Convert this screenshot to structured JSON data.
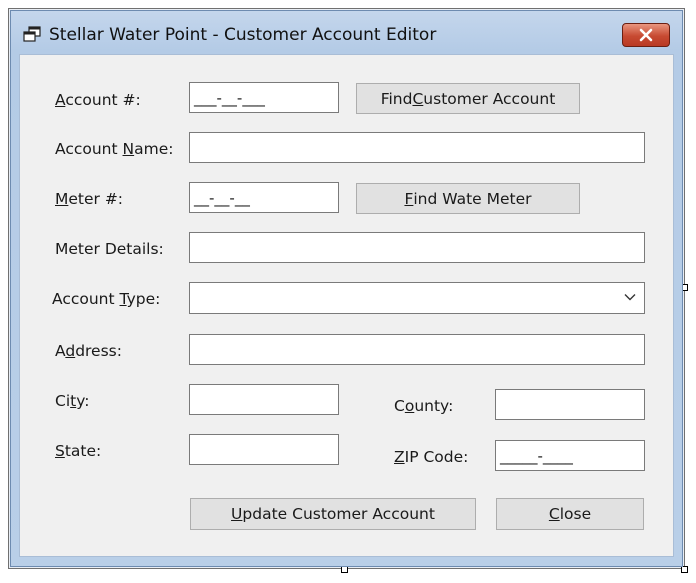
{
  "window": {
    "title": "Stellar Water Point - Customer Account Editor"
  },
  "form": {
    "account_number": {
      "label_pre": "",
      "label_key": "A",
      "label_post": "ccount #:",
      "mask": "___-__-___"
    },
    "find_account_button": {
      "pre": "Find ",
      "key": "C",
      "post": "ustomer Account"
    },
    "account_name": {
      "label_pre": "Account ",
      "label_key": "N",
      "label_post": "ame:",
      "value": ""
    },
    "meter_number": {
      "label_pre": "",
      "label_key": "M",
      "label_post": "eter #:",
      "mask": "__-__-__"
    },
    "find_meter_button": {
      "pre": "",
      "key": "F",
      "post": "ind Wate Meter"
    },
    "meter_details": {
      "label": "Meter Details:",
      "value": ""
    },
    "account_type": {
      "label_pre": "Account ",
      "label_key": "T",
      "label_post": "ype:",
      "value": ""
    },
    "address": {
      "label_pre": "A",
      "label_key": "d",
      "label_post": "dress:",
      "value": ""
    },
    "city": {
      "label_pre": "Ci",
      "label_key": "t",
      "label_post": "y:",
      "value": ""
    },
    "county": {
      "label_pre": "C",
      "label_key": "o",
      "label_post": "unty:",
      "value": ""
    },
    "state": {
      "label_pre": "",
      "label_key": "S",
      "label_post": "tate:",
      "value": ""
    },
    "zip_code": {
      "label_pre": "",
      "label_key": "Z",
      "label_post": "IP Code:",
      "mask": "_____-____"
    },
    "update_button": {
      "pre": "",
      "key": "U",
      "post": "pdate Customer Account"
    },
    "close_button": {
      "pre": "",
      "key": "C",
      "post": "lose"
    }
  }
}
